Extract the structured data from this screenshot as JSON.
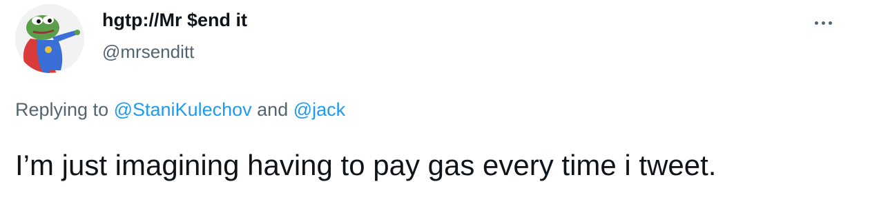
{
  "author": {
    "display_name": "hgtp://Mr $end it",
    "handle": "@mrsenditt",
    "avatar_icon": "pepe-superhero-avatar"
  },
  "menu": {
    "icon": "more-options-icon"
  },
  "reply": {
    "prefix": "Replying to",
    "mention_1": "@StaniKulechov",
    "conjunction": "and",
    "mention_2": "@jack"
  },
  "tweet": {
    "text": "I’m just imagining having to pay gas every time i tweet."
  },
  "colors": {
    "text_primary": "#0f1419",
    "text_secondary": "#536471",
    "link": "#1d9bf0"
  }
}
